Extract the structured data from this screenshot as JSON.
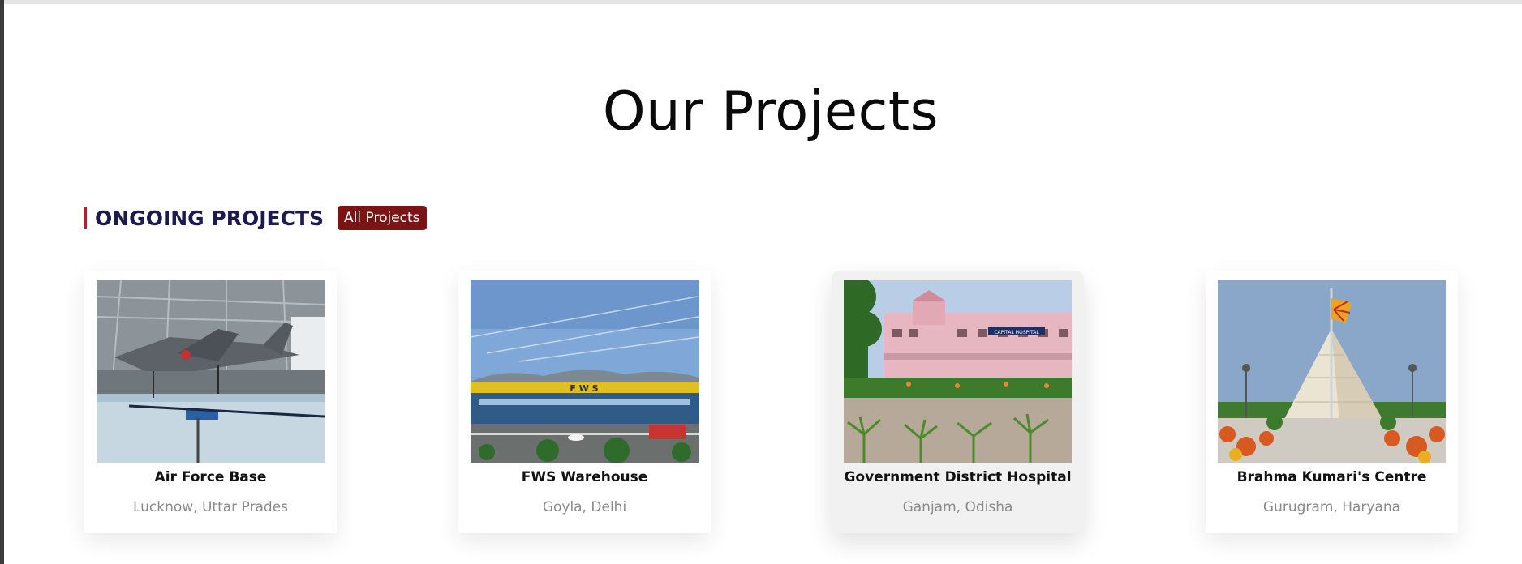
{
  "page": {
    "title": "Our Projects"
  },
  "section": {
    "title": "ONGOING PROJECTS",
    "button_label": "All Projects",
    "accent_color": "#b0202a",
    "button_color": "#7b1414",
    "title_color": "#1c1a4f"
  },
  "projects": [
    {
      "name": "Air Force Base",
      "location": "Lucknow, Uttar Prades",
      "image": "fighter-jet-hangar-photo"
    },
    {
      "name": "FWS Warehouse",
      "location": "Goyla, Delhi",
      "image": "warehouse-photo",
      "sign": "F W S"
    },
    {
      "name": "Government District Hospital",
      "location": "Ganjam, Odisha",
      "image": "hospital-photo",
      "sign": "CAPITAL HOSPITAL"
    },
    {
      "name": "Brahma Kumari's Centre",
      "location": "Gurugram, Haryana",
      "image": "pyramid-centre-photo"
    }
  ]
}
